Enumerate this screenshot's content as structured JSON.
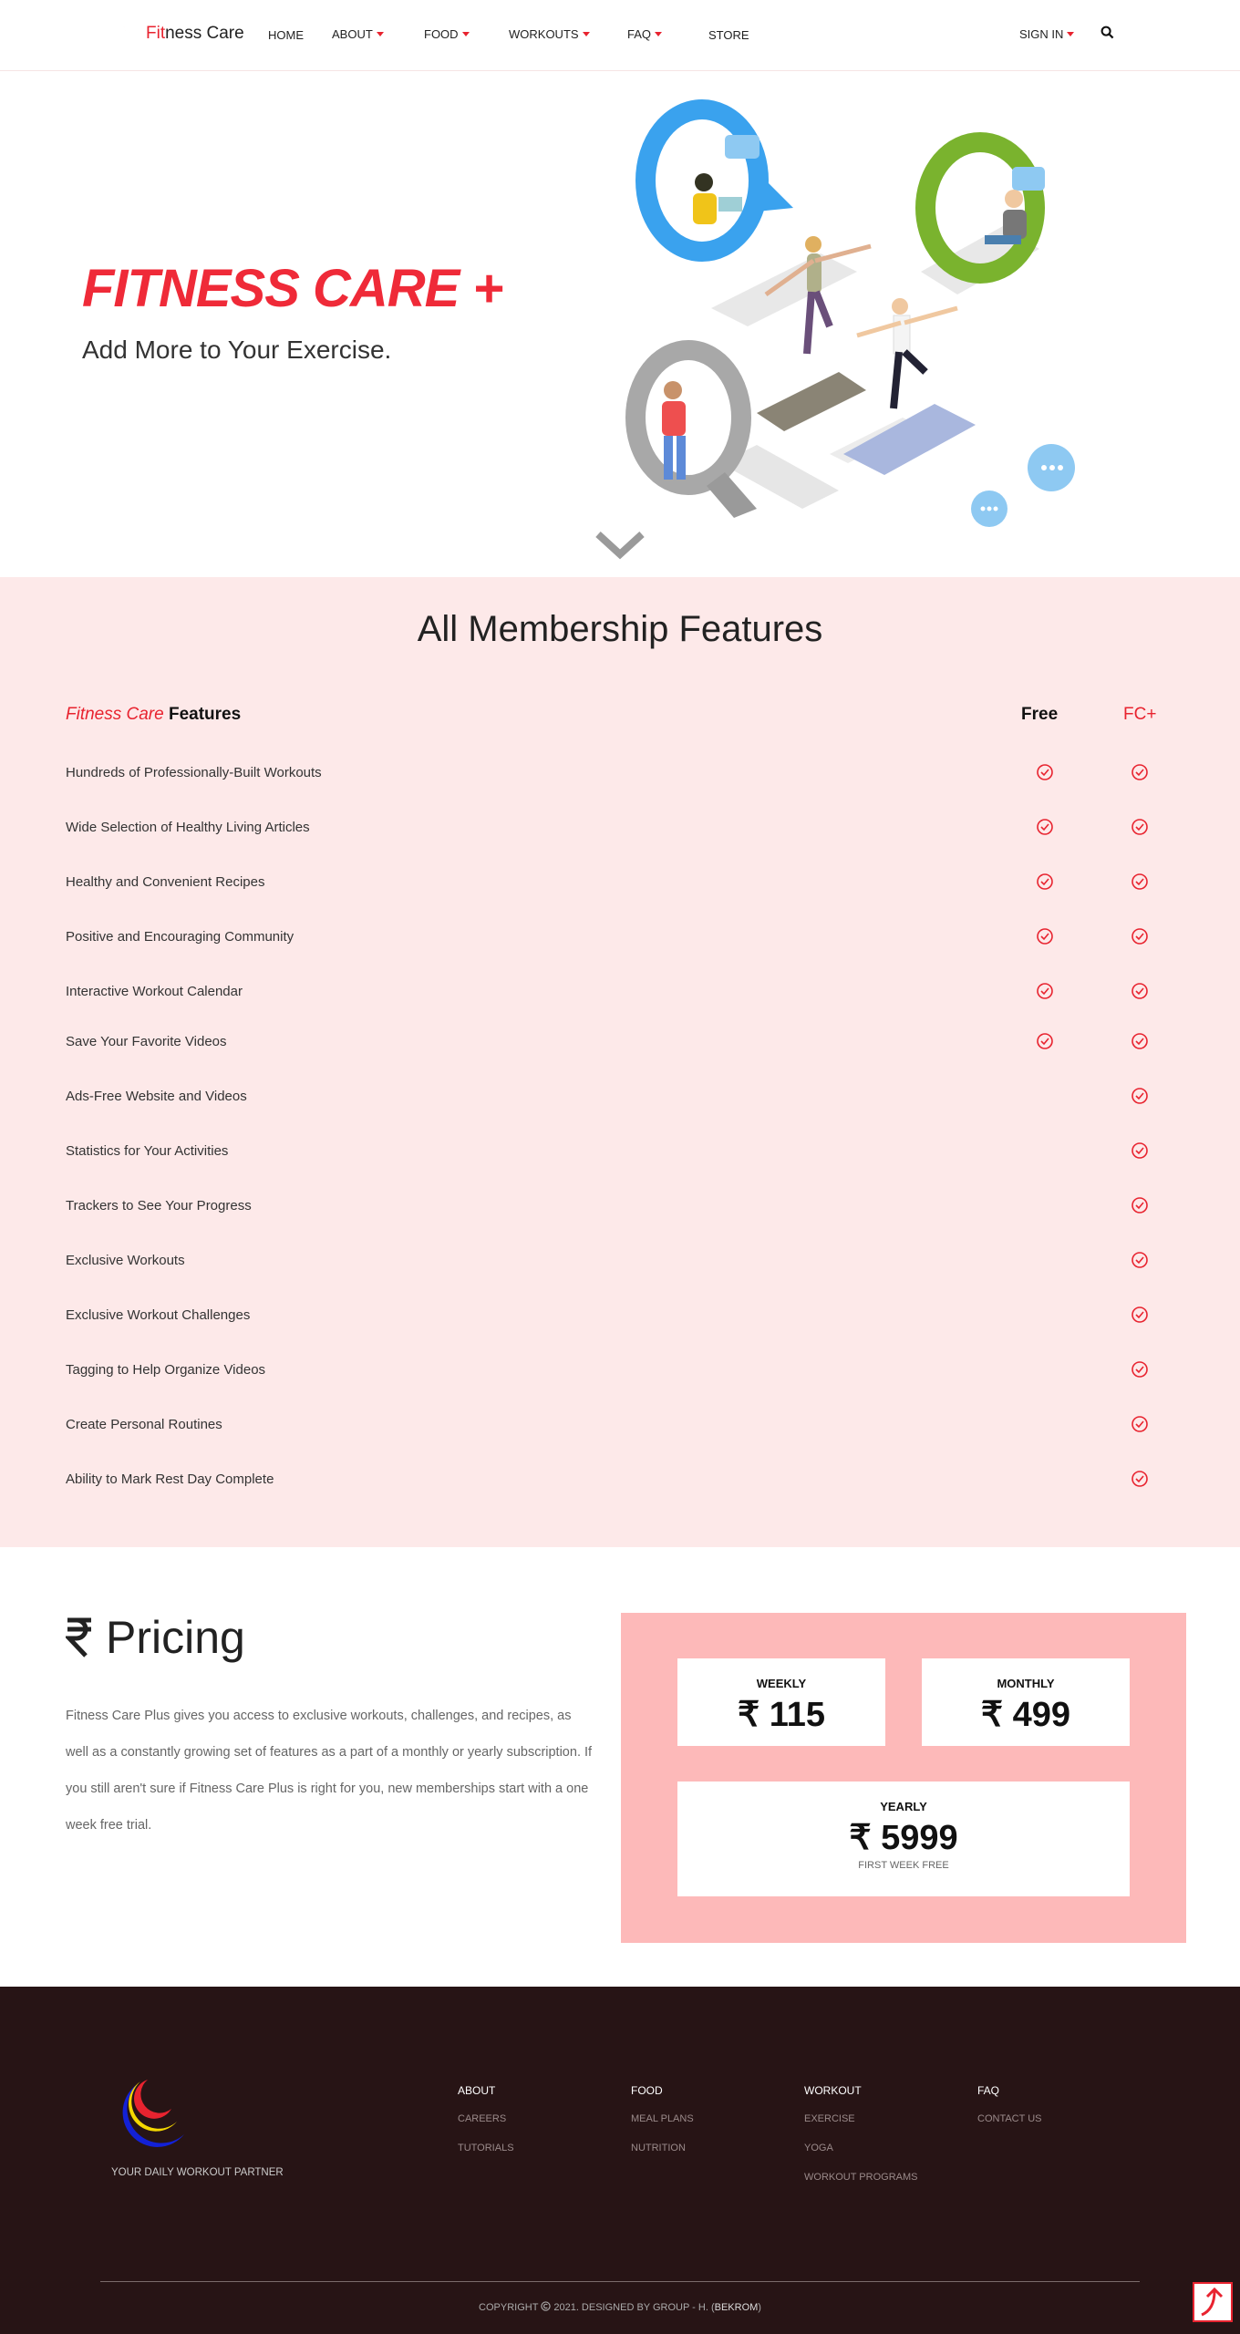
{
  "nav": {
    "brand_fit": "Fit",
    "brand_rest": "ness Care",
    "items": [
      {
        "label": "HOME",
        "dropdown": false
      },
      {
        "label": "ABOUT",
        "dropdown": true
      },
      {
        "label": "FOOD",
        "dropdown": true
      },
      {
        "label": "WORKOUTS",
        "dropdown": true
      },
      {
        "label": "FAQ",
        "dropdown": true
      },
      {
        "label": "STORE",
        "dropdown": false
      }
    ],
    "sign_in": "SIGN IN",
    "search_icon": "search-icon"
  },
  "hero": {
    "title": "FITNESS CARE +",
    "subtitle": "Add More to Your Exercise.",
    "scroll_icon": "chevron-down-icon"
  },
  "features": {
    "title": "All Membership Features",
    "head_brand": "Fitness Care",
    "head_rest": " Features",
    "col_free": "Free",
    "col_plus": "FC+",
    "rows": [
      {
        "label": "Hundreds of Professionally-Built Workouts",
        "free": true,
        "plus": true
      },
      {
        "label": "Wide Selection of Healthy Living Articles",
        "free": true,
        "plus": true
      },
      {
        "label": "Healthy and Convenient Recipes",
        "free": true,
        "plus": true
      },
      {
        "label": "Positive and Encouraging Community",
        "free": true,
        "plus": true
      },
      {
        "label": "Interactive Workout Calendar",
        "free": true,
        "plus": true
      },
      {
        "label": "Save Your Favorite Videos",
        "free": true,
        "plus": true
      },
      {
        "label": "Ads-Free Website and Videos",
        "free": false,
        "plus": true
      },
      {
        "label": "Statistics for Your Activities",
        "free": false,
        "plus": true
      },
      {
        "label": "Trackers to See Your Progress",
        "free": false,
        "plus": true
      },
      {
        "label": "Exclusive Workouts",
        "free": false,
        "plus": true
      },
      {
        "label": "Exclusive Workout Challenges",
        "free": false,
        "plus": true
      },
      {
        "label": "Tagging to Help Organize Videos",
        "free": false,
        "plus": true
      },
      {
        "label": "Create Personal Routines",
        "free": false,
        "plus": true
      },
      {
        "label": "Ability to Mark Rest Day Complete",
        "free": false,
        "plus": true
      }
    ]
  },
  "pricing": {
    "title": "Pricing",
    "currency_icon": "rupee-icon",
    "description": "Fitness Care Plus gives you access to exclusive workouts, challenges, and recipes, as well as a constantly growing set of features as a part of a monthly or yearly subscription. If you still aren't sure if Fitness Care Plus is right for you, new memberships start with a one week free trial.",
    "plans": [
      {
        "label": "WEEKLY",
        "price": "₹ 115"
      },
      {
        "label": "MONTHLY",
        "price": "₹ 499"
      },
      {
        "label": "YEARLY",
        "price": "₹ 5999",
        "note": "FIRST WEEK FREE"
      }
    ]
  },
  "footer": {
    "tagline": "YOUR DAILY WORKOUT PARTNER",
    "columns": [
      {
        "heading": "ABOUT",
        "links": [
          "CAREERS",
          "TUTORIALS"
        ]
      },
      {
        "heading": "FOOD",
        "links": [
          "MEAL PLANS",
          "NUTRITION"
        ]
      },
      {
        "heading": "WORKOUT",
        "links": [
          "EXERCISE",
          "YOGA",
          "WORKOUT PROGRAMS"
        ]
      },
      {
        "heading": "FAQ",
        "links": [
          "CONTACT US"
        ]
      }
    ],
    "copyright_pre": "COPYRIGHT",
    "copyright_mid": "2021. DESIGNED BY GROUP - H. (",
    "copyright_brand": "BEKROM",
    "copyright_post": ")"
  },
  "colors": {
    "accent": "#e8232f",
    "features_bg": "#fde9e9",
    "pricing_panel": "#fdb9b9",
    "footer_bg": "#271415"
  }
}
